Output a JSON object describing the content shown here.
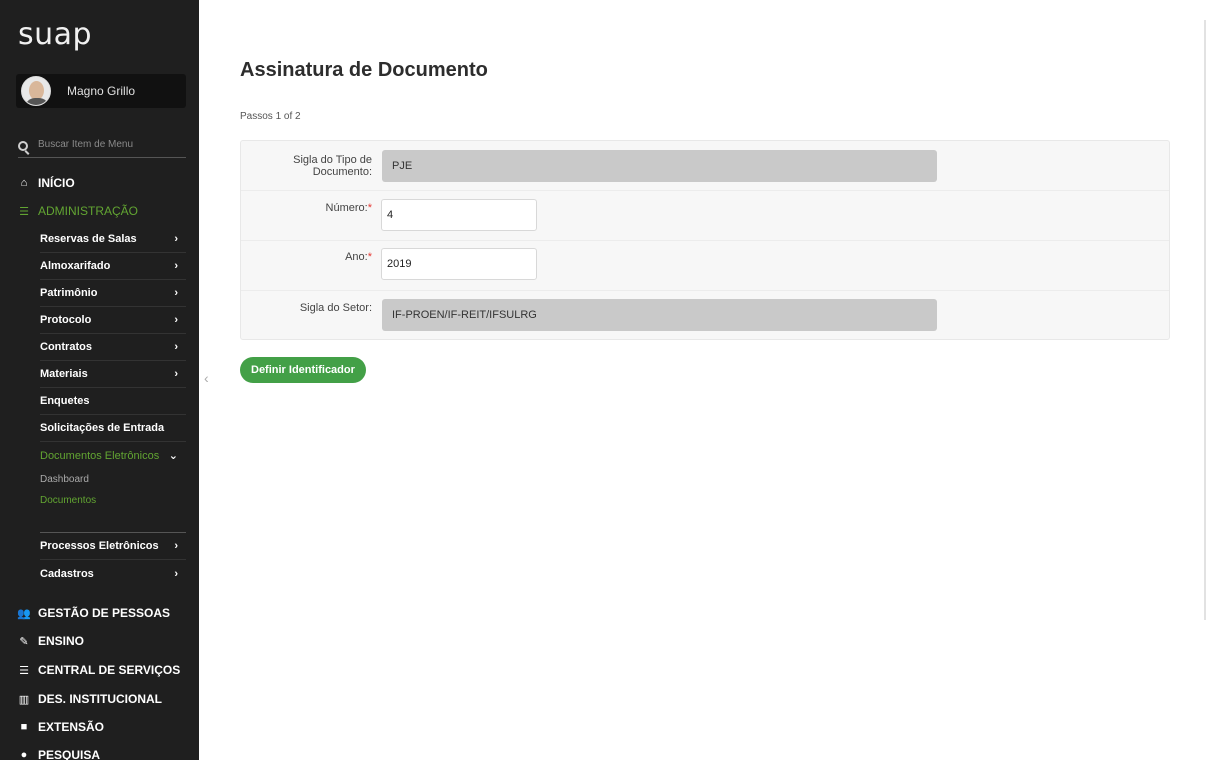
{
  "app": {
    "logo": "suap"
  },
  "user": {
    "name": "Magno Grillo"
  },
  "search": {
    "placeholder": "Buscar Item de Menu"
  },
  "sidebar": {
    "top": [
      {
        "icon": "home-icon",
        "glyph": "⌂",
        "label": "INÍCIO"
      },
      {
        "icon": "admin-icon",
        "glyph": "☰",
        "label": "ADMINISTRAÇÃO"
      }
    ],
    "admin_items": [
      {
        "label": "Reservas de Salas",
        "chevron": "›"
      },
      {
        "label": "Almoxarifado",
        "chevron": "›"
      },
      {
        "label": "Patrimônio",
        "chevron": "›"
      },
      {
        "label": "Protocolo",
        "chevron": "›"
      },
      {
        "label": "Contratos",
        "chevron": "›"
      },
      {
        "label": "Materiais",
        "chevron": "›"
      },
      {
        "label": "Enquetes",
        "chevron": ""
      },
      {
        "label": "Solicitações de Entrada",
        "chevron": ""
      },
      {
        "label": "Documentos Eletrônicos",
        "chevron": "⌄"
      }
    ],
    "docs_sub": [
      "Dashboard",
      "Documentos"
    ],
    "admin_items_after": [
      {
        "label": "Processos Eletrônicos",
        "chevron": "›"
      },
      {
        "label": "Cadastros",
        "chevron": "›"
      }
    ],
    "bottom": [
      {
        "icon": "people-icon",
        "glyph": "👥",
        "label": "GESTÃO DE PESSOAS"
      },
      {
        "icon": "pencil-icon",
        "glyph": "✎",
        "label": "ENSINO"
      },
      {
        "icon": "list-icon",
        "glyph": "☰",
        "label": "CENTRAL DE SERVIÇOS"
      },
      {
        "icon": "bar-chart-icon",
        "glyph": "▥",
        "label": "DES. INSTITUCIONAL"
      },
      {
        "icon": "briefcase-icon",
        "glyph": "■",
        "label": "EXTENSÃO"
      },
      {
        "icon": "search-icon",
        "glyph": "●",
        "label": "PESQUISA"
      }
    ]
  },
  "main": {
    "title": "Assinatura de Documento",
    "steps": "Passos 1 of 2",
    "fields": {
      "tipo": {
        "label_line1": "Sigla do Tipo de",
        "label_line2": "Documento:",
        "value": "PJE"
      },
      "numero": {
        "label": "Número:",
        "required": "*",
        "value": "4"
      },
      "ano": {
        "label": "Ano:",
        "required": "*",
        "value": "2019"
      },
      "setor": {
        "label": "Sigla do Setor:",
        "value": "IF-PROEN/IF-REIT/IFSULRG"
      }
    },
    "submit_label": "Definir Identificador"
  },
  "colors": {
    "sidebar_bg": "#1f1f1f",
    "accent_green": "#62a532",
    "button_green": "#43a047"
  }
}
